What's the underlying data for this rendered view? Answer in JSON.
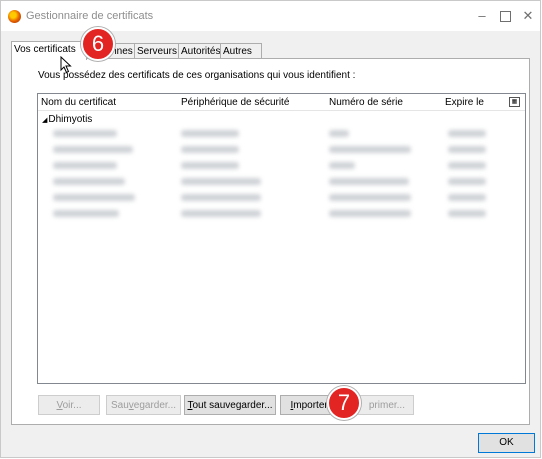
{
  "window": {
    "title": "Gestionnaire de certificats",
    "controls": {
      "minimize": "–",
      "close": "✕"
    }
  },
  "tabs": [
    {
      "label": "Vos certificats",
      "active": true
    },
    {
      "label": "Personnes",
      "active": false
    },
    {
      "label": "Serveurs",
      "active": false
    },
    {
      "label": "Autorités",
      "active": false
    },
    {
      "label": "Autres",
      "active": false
    }
  ],
  "panel": {
    "description": "Vous possédez des certificats de ces organisations qui vous identifient :"
  },
  "table": {
    "columns": [
      "Nom du certificat",
      "Périphérique de sécurité",
      "Numéro de série",
      "Expire le"
    ],
    "column_picker_icon": "column-picker-icon",
    "group": {
      "expander": "◢",
      "name": "Dhimyotis"
    }
  },
  "buttons": {
    "voir": {
      "accel": "V",
      "rest": "oir..."
    },
    "sauvegarder": {
      "pre": "Sau",
      "accel": "v",
      "post": "egarder..."
    },
    "tout": {
      "accel": "T",
      "rest": "out sauvegarder..."
    },
    "importer": {
      "accel": "I",
      "rest": "mporter..."
    },
    "supprimer": {
      "label": "primer..."
    },
    "ok": "OK"
  },
  "annotations": {
    "step_a": "6",
    "step_b": "7",
    "badge_color": "#e22423"
  }
}
